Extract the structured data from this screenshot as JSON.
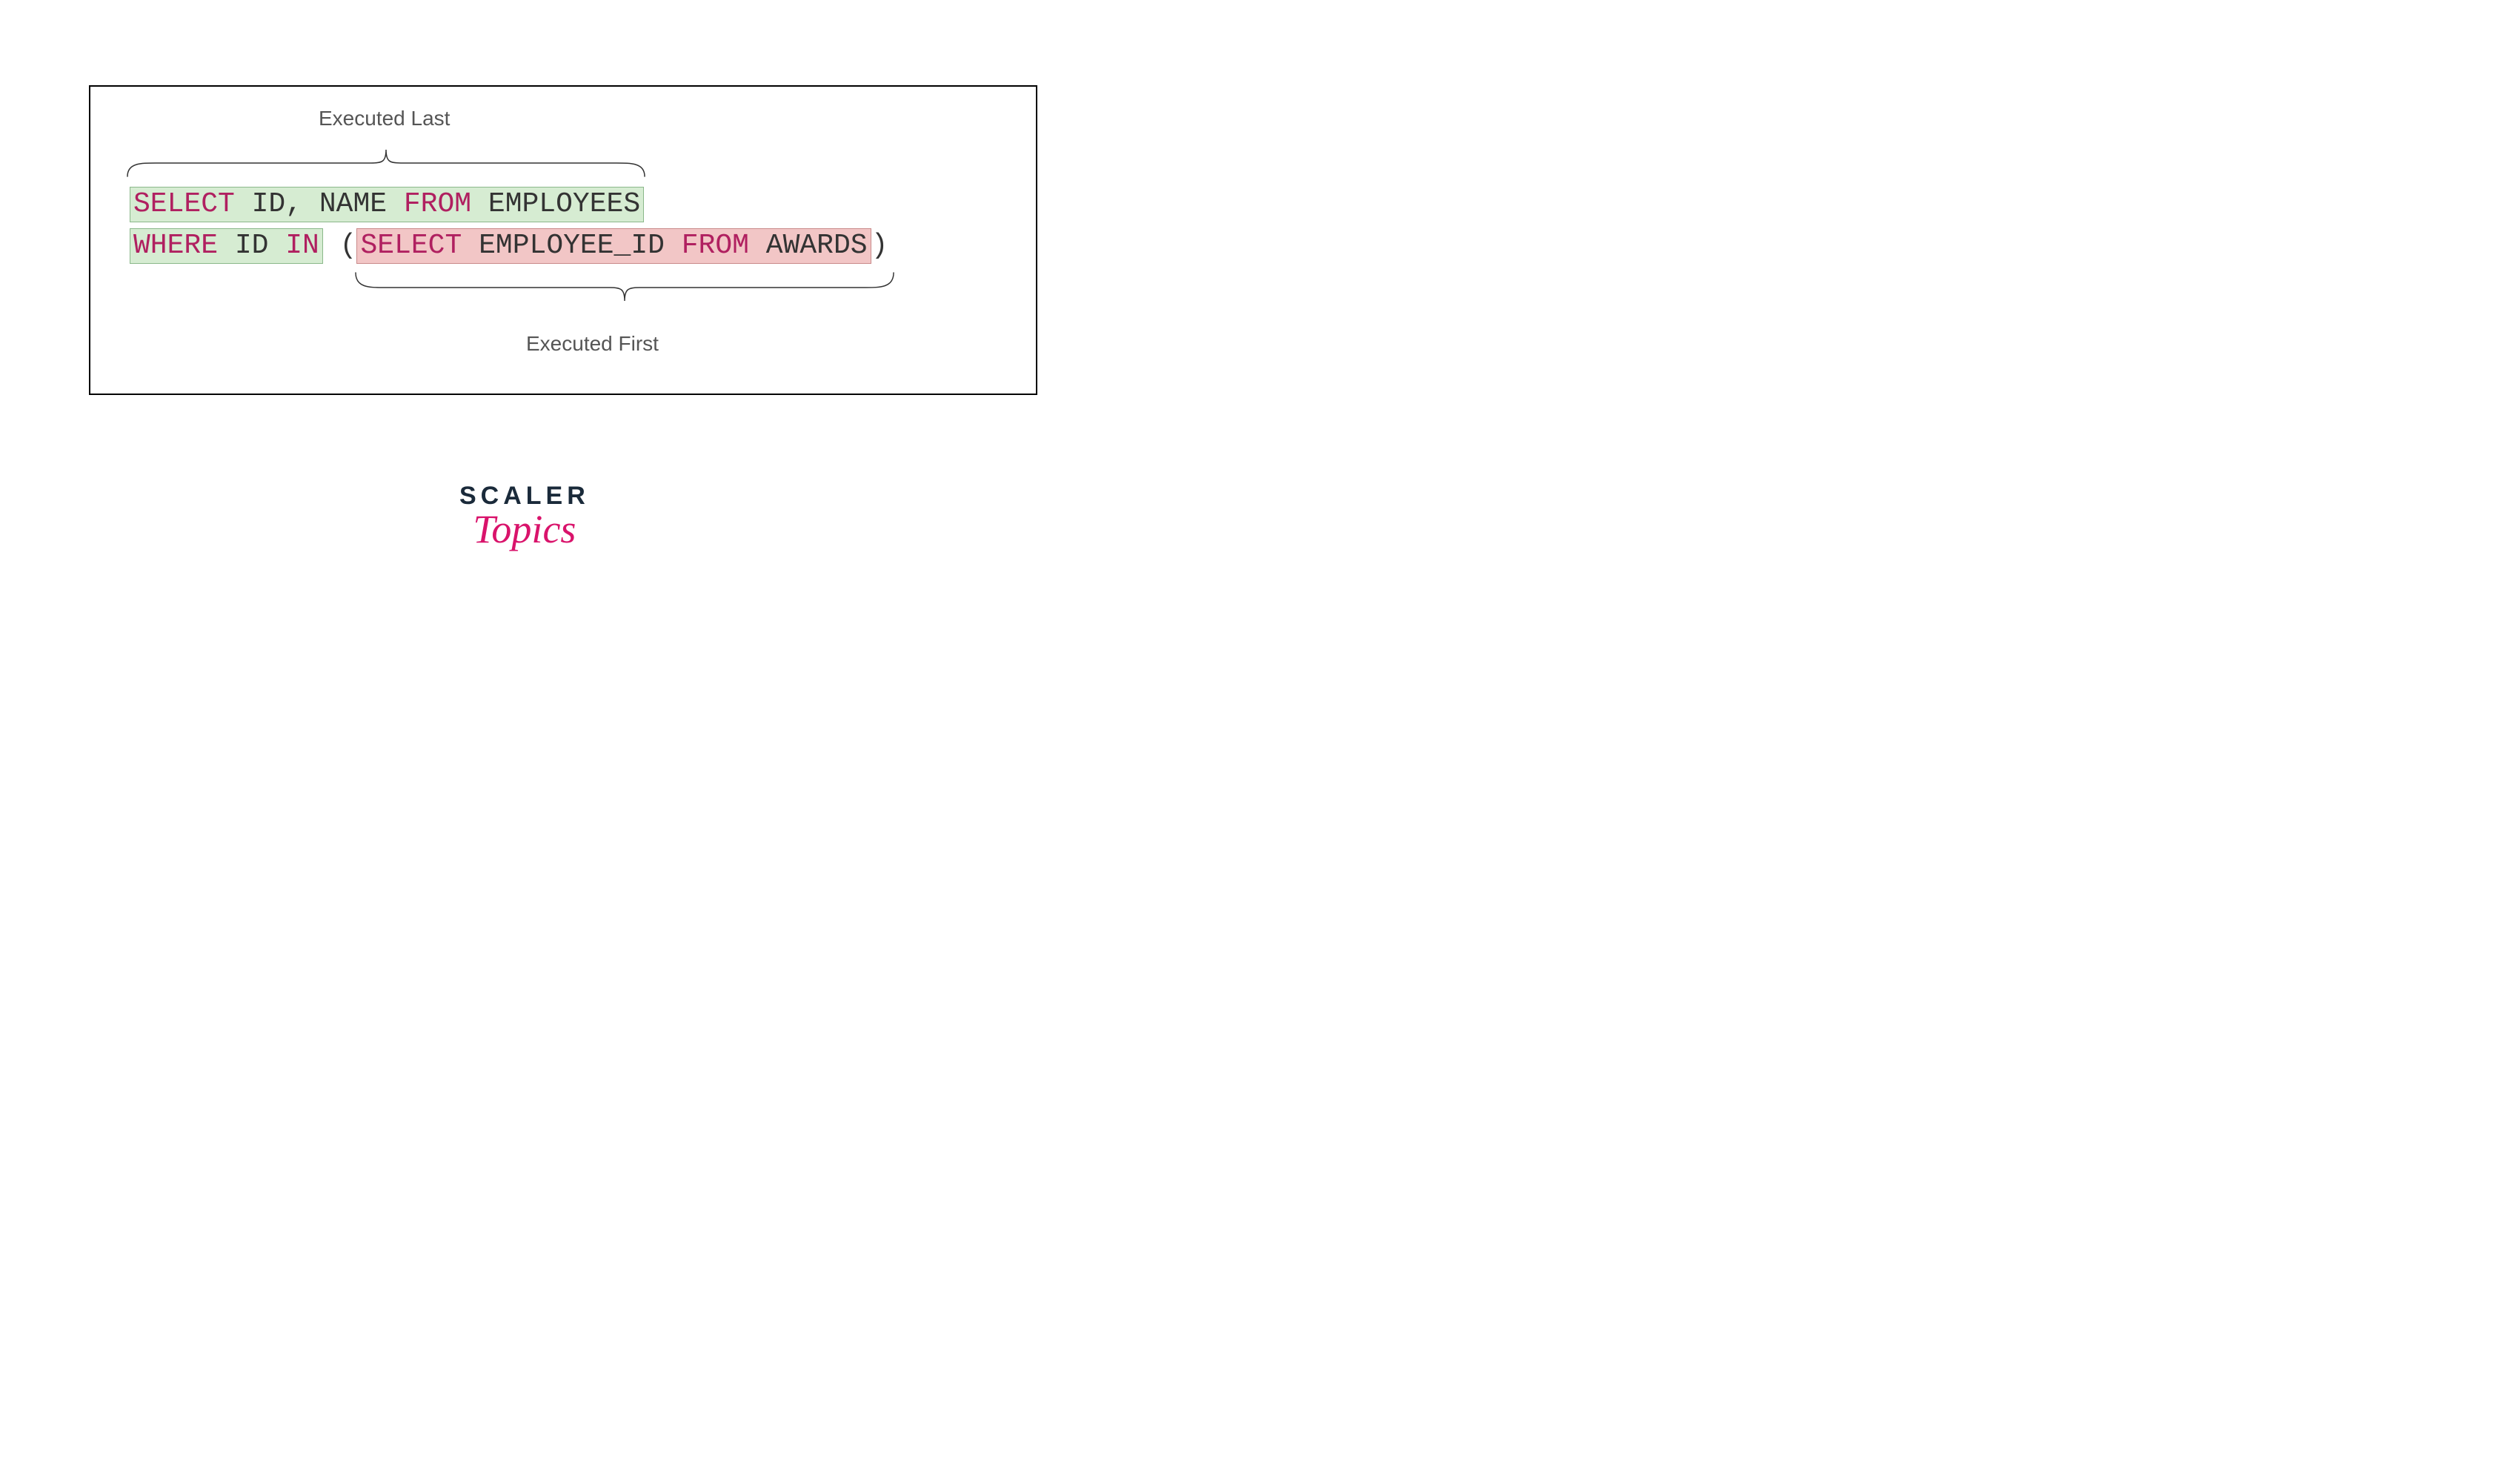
{
  "labels": {
    "top": "Executed Last",
    "bottom": "Executed First"
  },
  "sql": {
    "line1": {
      "kw_select": "SELECT",
      "cols": " ID, NAME ",
      "kw_from": "FROM",
      "table": " EMPLOYEES"
    },
    "line2": {
      "kw_where": "WHERE",
      "col": " ID ",
      "kw_in": "IN",
      "paren_open": " (",
      "inner_kw_select": "SELECT",
      "inner_cols": " EMPLOYEE_ID ",
      "inner_kw_from": "FROM",
      "inner_table": " AWARDS",
      "paren_close": ")"
    }
  },
  "logo": {
    "scaler": "SCALER",
    "topics": "Topics"
  },
  "colors": {
    "keyword": "#b02060",
    "outer_highlight_bg": "#d6ecd2",
    "outer_highlight_border": "#8bb88a",
    "inner_highlight_bg": "#f2c6c6",
    "inner_highlight_border": "#c98a8a"
  }
}
